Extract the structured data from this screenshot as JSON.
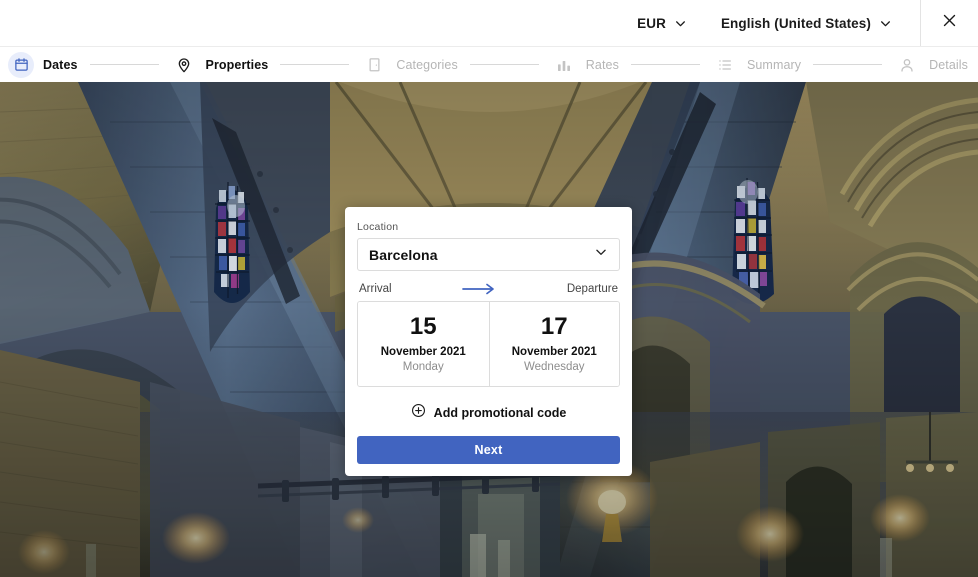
{
  "topbar": {
    "currency": {
      "label": "EUR",
      "icon": "chevron-down-icon"
    },
    "language": {
      "label": "English (United States)",
      "icon": "chevron-down-icon"
    },
    "close": {
      "icon": "close-icon"
    }
  },
  "stepper": {
    "steps": [
      {
        "label": "Dates",
        "icon": "calendar-icon",
        "state": "active"
      },
      {
        "label": "Properties",
        "icon": "location-pin-icon",
        "state": "done"
      },
      {
        "label": "Categories",
        "icon": "door-icon",
        "state": "todo"
      },
      {
        "label": "Rates",
        "icon": "bar-chart-icon",
        "state": "todo"
      },
      {
        "label": "Summary",
        "icon": "list-icon",
        "state": "todo"
      },
      {
        "label": "Details",
        "icon": "person-icon",
        "state": "todo"
      }
    ]
  },
  "card": {
    "location": {
      "label": "Location",
      "value": "Barcelona",
      "icon": "chevron-down-icon"
    },
    "arrival_label": "Arrival",
    "departure_label": "Departure",
    "arrow_icon": "arrow-right-icon",
    "arrival": {
      "day": "15",
      "month_year": "November 2021",
      "weekday": "Monday"
    },
    "departure": {
      "day": "17",
      "month_year": "November 2021",
      "weekday": "Wednesday"
    },
    "promo": {
      "icon": "plus-circle-icon",
      "label": "Add promotional code"
    },
    "next_label": "Next"
  },
  "colors": {
    "accent": "#4164c0",
    "accent_soft": "#e8edfb",
    "text": "#111111",
    "muted": "#b5b5b5",
    "border": "#dcdcdc"
  },
  "background": {
    "description": "Gothic cathedral interior with vaulted stone ceiling and stained glass windows"
  }
}
